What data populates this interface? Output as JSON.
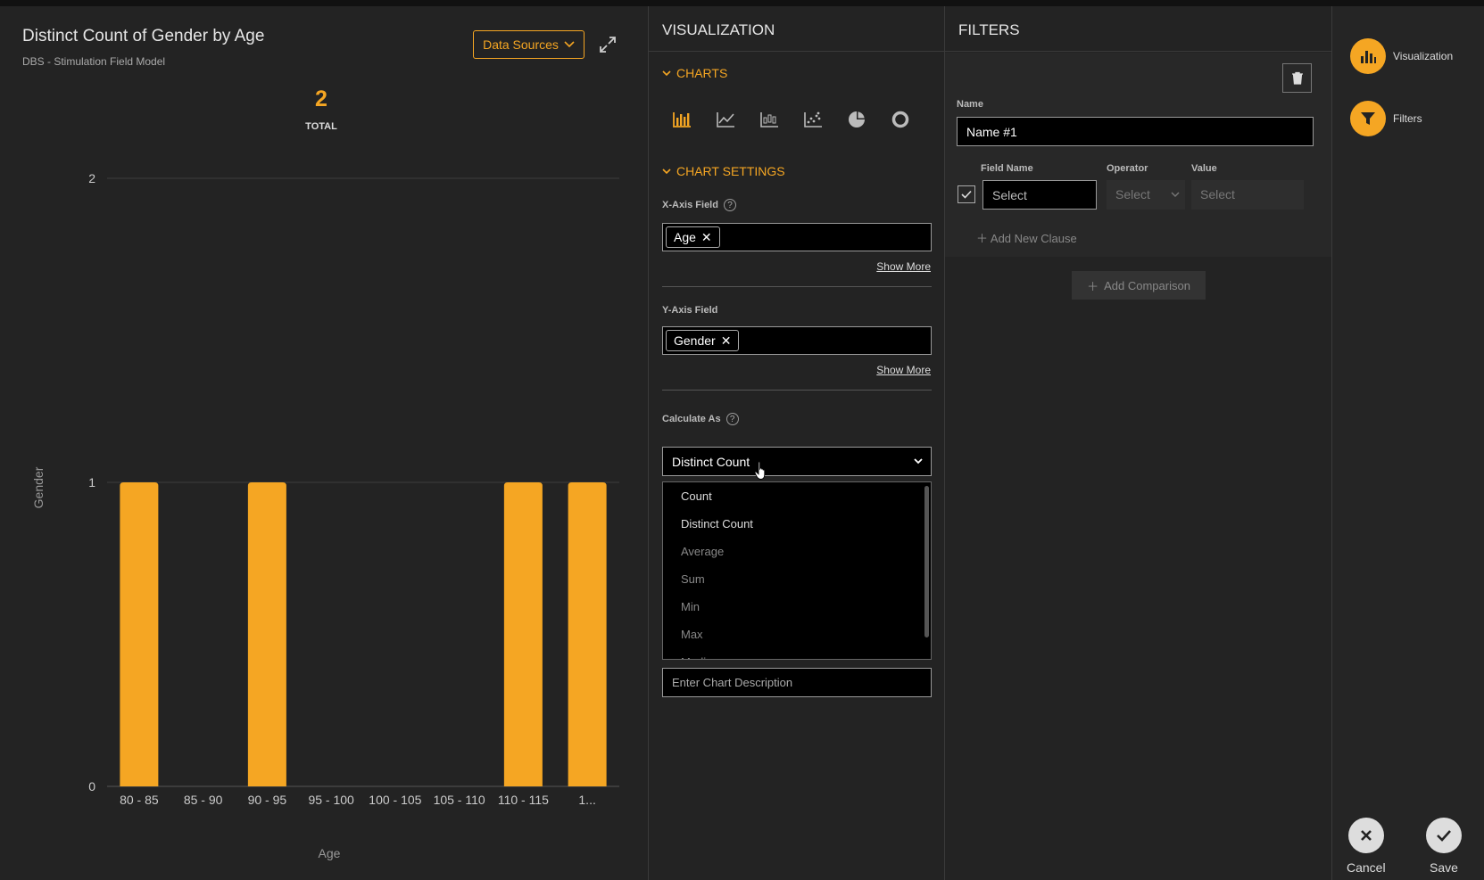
{
  "chart": {
    "title": "Distinct Count of Gender by Age",
    "subtitle": "DBS - Stimulation Field Model",
    "data_sources_label": "Data Sources",
    "total_value": "2",
    "total_label": "TOTAL"
  },
  "chart_data": {
    "type": "bar",
    "categories": [
      "80 - 85",
      "85 - 90",
      "90 - 95",
      "95 - 100",
      "100 - 105",
      "105 - 110",
      "110 - 115",
      "1..."
    ],
    "values": [
      1,
      0,
      1,
      0,
      0,
      0,
      1,
      1
    ],
    "xlabel": "Age",
    "ylabel": "Gender",
    "ylim": [
      0,
      2
    ],
    "yticks": [
      "0",
      "1",
      "2"
    ],
    "grid": true,
    "color": "#f5a623"
  },
  "visualization": {
    "header": "VISUALIZATION",
    "charts_section": "CHARTS",
    "chart_types": [
      "bar-chart-icon",
      "line-chart-icon",
      "box-plot-icon",
      "scatter-chart-icon",
      "pie-chart-icon",
      "donut-chart-icon"
    ],
    "settings_section": "CHART SETTINGS",
    "x_axis_label": "X-Axis Field",
    "x_axis_tag": "Age",
    "y_axis_label": "Y-Axis Field",
    "y_axis_tag": "Gender",
    "show_more": "Show More",
    "calculate_label": "Calculate As",
    "calculate_value": "Distinct Count",
    "calculate_options": [
      "Count",
      "Distinct Count",
      "Average",
      "Sum",
      "Min",
      "Max",
      "Median"
    ],
    "description_placeholder": "Enter Chart Description"
  },
  "filters": {
    "header": "FILTERS",
    "name_label": "Name",
    "name_value": "Name #1",
    "field_name_label": "Field Name",
    "operator_label": "Operator",
    "value_label": "Value",
    "field_name_placeholder": "Select",
    "operator_placeholder": "Select",
    "value_placeholder": "Select",
    "add_clause": "Add New Clause",
    "add_comparison": "Add Comparison"
  },
  "sidebar": {
    "visualization": "Visualization",
    "filters": "Filters",
    "cancel": "Cancel",
    "save": "Save"
  },
  "colors": {
    "accent": "#f5a623",
    "background": "#232323"
  }
}
